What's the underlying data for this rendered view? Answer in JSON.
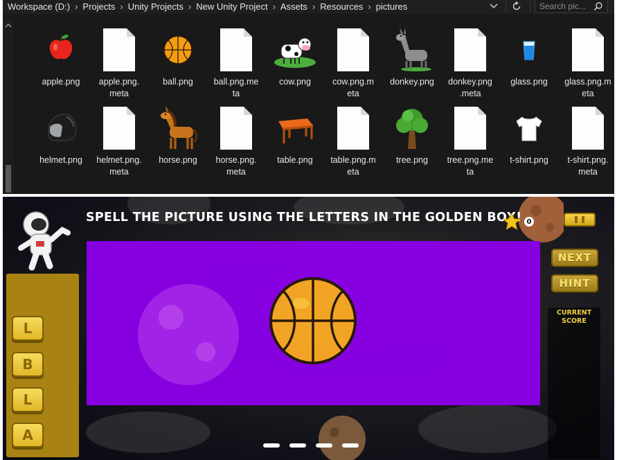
{
  "explorer": {
    "breadcrumb": [
      "Workspace (D:)",
      "Projects",
      "Unity Projects",
      "New Unity Project",
      "Assets",
      "Resources",
      "pictures"
    ],
    "search": {
      "placeholder": "Search pic..."
    },
    "files": [
      {
        "name": "apple.png",
        "icon": "apple-icon"
      },
      {
        "name": "apple.png.meta",
        "icon": "document-icon"
      },
      {
        "name": "ball.png",
        "icon": "basketball-icon"
      },
      {
        "name": "ball.png.meta",
        "icon": "document-icon"
      },
      {
        "name": "cow.png",
        "icon": "cow-icon"
      },
      {
        "name": "cow.png.meta",
        "icon": "document-icon"
      },
      {
        "name": "donkey.png",
        "icon": "donkey-icon"
      },
      {
        "name": "donkey.png.meta",
        "icon": "document-icon"
      },
      {
        "name": "glass.png",
        "icon": "glass-icon"
      },
      {
        "name": "glass.png.meta",
        "icon": "document-icon"
      },
      {
        "name": "helmet.png",
        "icon": "helmet-icon"
      },
      {
        "name": "helmet.png.meta",
        "icon": "document-icon"
      },
      {
        "name": "horse.png",
        "icon": "horse-icon"
      },
      {
        "name": "horse.png.meta",
        "icon": "document-icon"
      },
      {
        "name": "table.png",
        "icon": "table-icon"
      },
      {
        "name": "table.png.meta",
        "icon": "document-icon"
      },
      {
        "name": "tree.png",
        "icon": "tree-icon"
      },
      {
        "name": "tree.png.meta",
        "icon": "document-icon"
      },
      {
        "name": "t-shirt.png",
        "icon": "tshirt-icon"
      },
      {
        "name": "t-shirt.png.meta",
        "icon": "document-icon"
      }
    ],
    "file_labels": [
      [
        "apple.png"
      ],
      [
        "apple.png.",
        "meta"
      ],
      [
        "ball.png"
      ],
      [
        "ball.png.me",
        "ta"
      ],
      [
        "cow.png"
      ],
      [
        "cow.png.m",
        "eta"
      ],
      [
        "donkey.png"
      ],
      [
        "donkey.png",
        ".meta"
      ],
      [
        "glass.png"
      ],
      [
        "glass.png.m",
        "eta"
      ],
      [
        "helmet.png"
      ],
      [
        "helmet.png.",
        "meta"
      ],
      [
        "horse.png"
      ],
      [
        "horse.png.",
        "meta"
      ],
      [
        "table.png"
      ],
      [
        "table.png.m",
        "eta"
      ],
      [
        "tree.png"
      ],
      [
        "tree.png.me",
        "ta"
      ],
      [
        "t-shirt.png"
      ],
      [
        "t-shirt.png.",
        "meta"
      ]
    ]
  },
  "game": {
    "instruction": "SPELL THE PICTURE USING THE LETTERS IN THE GOLDEN BOX!",
    "star_count": "0",
    "buttons": {
      "next": "NEXT",
      "hint": "HINT"
    },
    "score_label": "CURRENT\nSCORE",
    "letters": [
      "L",
      "B",
      "L",
      "A"
    ],
    "answer_slots": 4,
    "picture": "basketball",
    "colors": {
      "panel": "#8a00e6",
      "gold": "#e2b727",
      "letter_panel": "#a88212"
    }
  }
}
